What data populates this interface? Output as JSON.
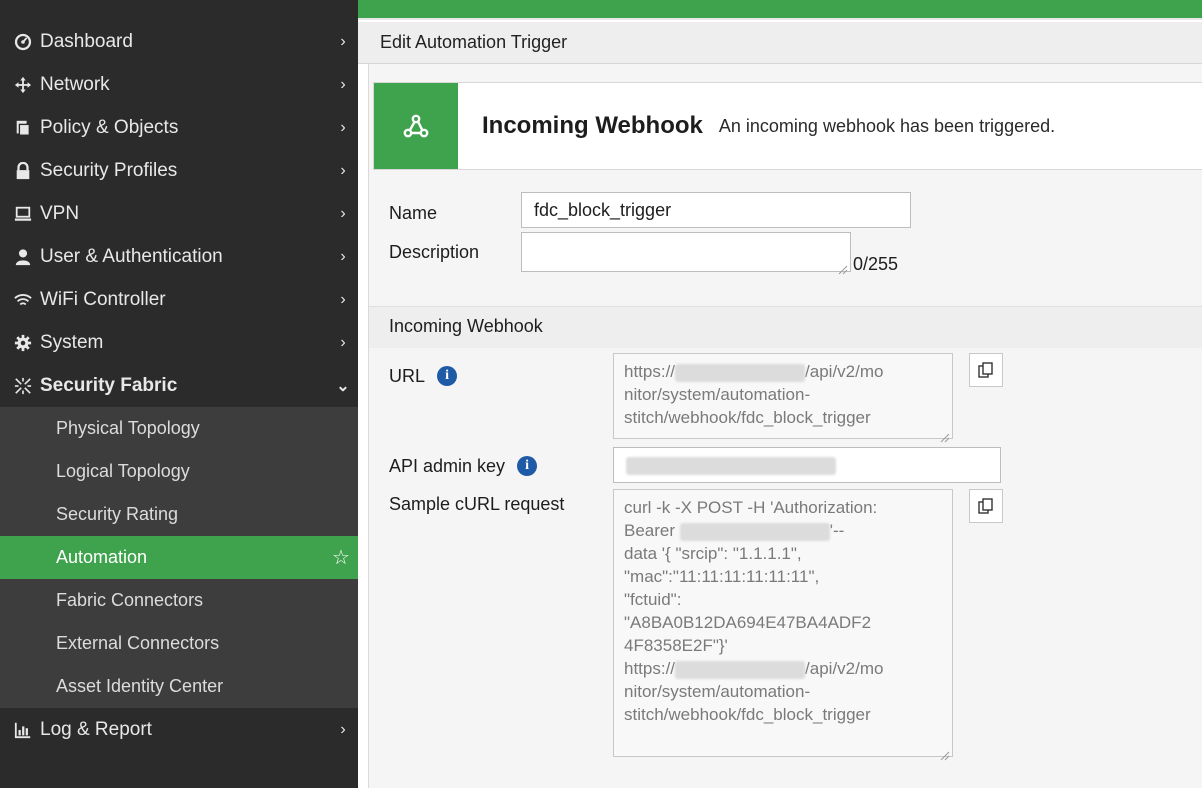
{
  "sidebar": {
    "items": [
      {
        "label": "Dashboard",
        "icon": "dashboard-icon"
      },
      {
        "label": "Network",
        "icon": "network-icon"
      },
      {
        "label": "Policy & Objects",
        "icon": "policy-icon"
      },
      {
        "label": "Security Profiles",
        "icon": "lock-icon"
      },
      {
        "label": "VPN",
        "icon": "laptop-icon"
      },
      {
        "label": "User & Authentication",
        "icon": "user-icon"
      },
      {
        "label": "WiFi Controller",
        "icon": "wifi-icon"
      },
      {
        "label": "System",
        "icon": "gear-icon"
      },
      {
        "label": "Security Fabric",
        "icon": "fabric-icon"
      }
    ],
    "subitems": [
      {
        "label": "Physical Topology"
      },
      {
        "label": "Logical Topology"
      },
      {
        "label": "Security Rating"
      },
      {
        "label": "Automation"
      },
      {
        "label": "Fabric Connectors"
      },
      {
        "label": "External Connectors"
      },
      {
        "label": "Asset Identity Center"
      }
    ],
    "bottom_item": {
      "label": "Log & Report",
      "icon": "report-icon"
    },
    "star_glyph": "☆"
  },
  "breadcrumb": {
    "title": "Edit Automation Trigger"
  },
  "trigger": {
    "title": "Incoming Webhook",
    "description": "An incoming webhook has been triggered.",
    "icon": "webhook-icon"
  },
  "form": {
    "name_label": "Name",
    "name_value": "fdc_block_trigger",
    "description_label": "Description",
    "description_value": "",
    "description_counter": "0/255",
    "section_title": "Incoming Webhook",
    "url_label": "URL",
    "url_line1_start": "https://",
    "url_line1_end": "/api/v2/mo",
    "url_rest": "nitor/system/automation-\nstitch/webhook/fdc_block_trigger",
    "api_key_label": "API admin key",
    "curl_label": "Sample cURL request",
    "curl_line1": "curl -k -X POST -H 'Authorization:",
    "curl_line2_start": "Bearer",
    "curl_line2_end": "'--",
    "curl_middle": "data '{ \"srcip\": \"1.1.1.1\",\n\"mac\":\"11:11:11:11:11:11\",\n\"fctuid\":\n\"A8BA0B12DA694E47BA4ADF2\n4F8358E2F\"}'",
    "curl_url_start": "https://",
    "curl_url_end": "/api/v2/mo",
    "curl_rest": "nitor/system/automation-\nstitch/webhook/fdc_block_trigger"
  },
  "colors": {
    "accent_green": "#3fa34d",
    "sidebar_bg": "#2b2b2b",
    "info_blue": "#1f5aa6"
  }
}
